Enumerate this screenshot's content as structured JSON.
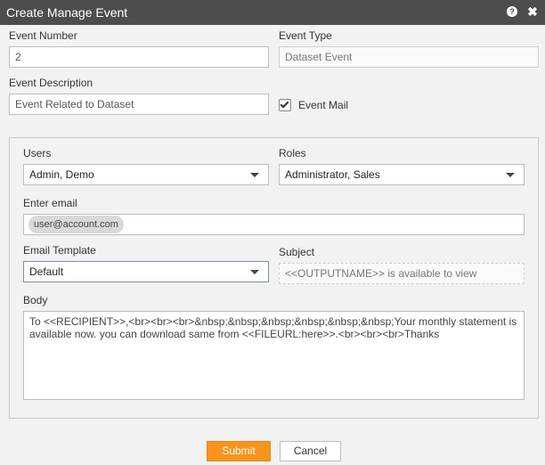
{
  "dialog": {
    "title": "Create Manage Event",
    "help_icon": "question-icon",
    "close_icon": "close-icon"
  },
  "event_number": {
    "label": "Event Number",
    "value": "2"
  },
  "event_type": {
    "label": "Event Type",
    "value": "Dataset Event"
  },
  "event_description": {
    "label": "Event Description",
    "value": "Event Related to Dataset"
  },
  "event_mail": {
    "label": "Event Mail",
    "checked": true
  },
  "users": {
    "label": "Users",
    "value": "Admin, Demo"
  },
  "roles": {
    "label": "Roles",
    "value": "Administrator, Sales"
  },
  "email": {
    "label": "Enter email",
    "chips": [
      "user@account.com"
    ]
  },
  "email_template": {
    "label": "Email Template",
    "value": "Default"
  },
  "subject": {
    "label": "Subject",
    "value": "<<OUTPUTNAME>> is available to view"
  },
  "body": {
    "label": "Body",
    "value": "To <<RECIPIENT>>,<br><br><br>&nbsp;&nbsp;&nbsp;&nbsp;&nbsp;&nbsp;Your monthly statement is available now. you can download same from <<FILEURL:here>>.<br><br><br>Thanks"
  },
  "buttons": {
    "submit": "Submit",
    "cancel": "Cancel"
  },
  "colors": {
    "titlebar": "#4d4d4d",
    "submit": "#f7941d"
  }
}
